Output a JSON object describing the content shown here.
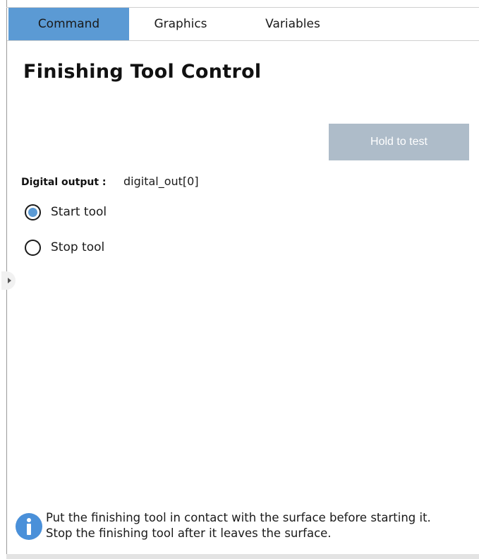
{
  "tabs": [
    {
      "label": "Command",
      "active": true
    },
    {
      "label": "Graphics",
      "active": false
    },
    {
      "label": "Variables",
      "active": false
    }
  ],
  "title": "Finishing Tool Control",
  "test_button": {
    "label": "Hold to test",
    "enabled": false
  },
  "digital_output": {
    "label": "Digital output :",
    "value": "digital_out[0]"
  },
  "radios": [
    {
      "label": "Start tool",
      "checked": true
    },
    {
      "label": "Stop tool",
      "checked": false
    }
  ],
  "info": {
    "icon": "info-icon",
    "line1": "Put the finishing tool in contact with the surface before starting it.",
    "line2": "Stop the finishing tool after it leaves the surface."
  },
  "colors": {
    "accent": "#5b9ad4",
    "disabled_button": "#aebcc9",
    "info_icon": "#4a90d9"
  }
}
